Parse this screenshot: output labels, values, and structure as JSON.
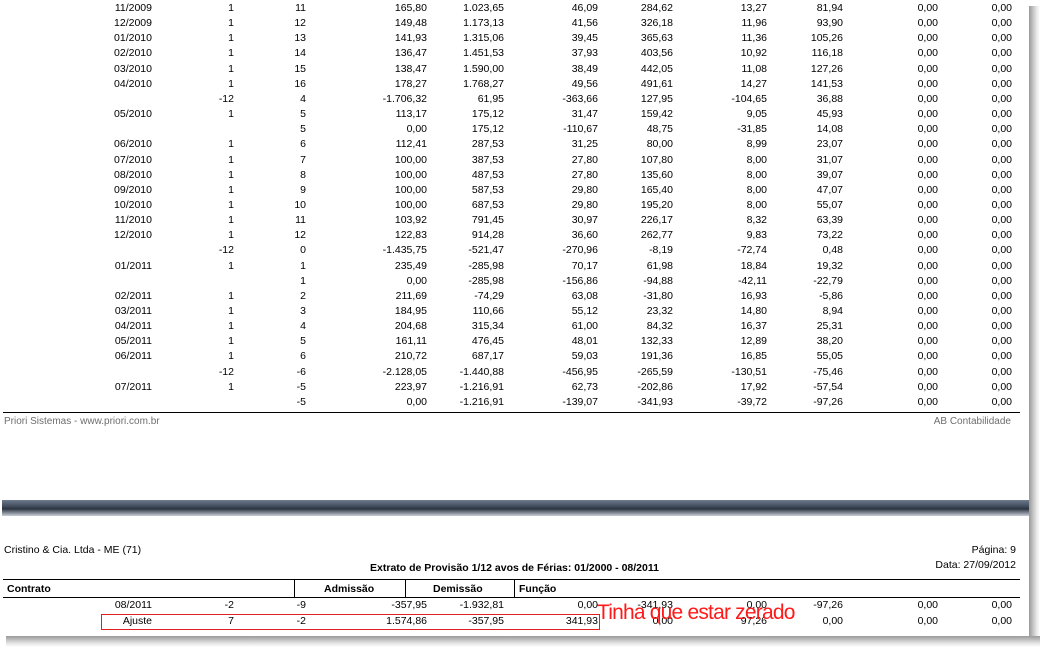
{
  "top_rows": [
    [
      "11/2009",
      "1",
      "11",
      "165,80",
      "1.023,65",
      "46,09",
      "284,62",
      "13,27",
      "81,94",
      "0,00",
      "0,00"
    ],
    [
      "12/2009",
      "1",
      "12",
      "149,48",
      "1.173,13",
      "41,56",
      "326,18",
      "11,96",
      "93,90",
      "0,00",
      "0,00"
    ],
    [
      "01/2010",
      "1",
      "13",
      "141,93",
      "1.315,06",
      "39,45",
      "365,63",
      "11,36",
      "105,26",
      "0,00",
      "0,00"
    ],
    [
      "02/2010",
      "1",
      "14",
      "136,47",
      "1.451,53",
      "37,93",
      "403,56",
      "10,92",
      "116,18",
      "0,00",
      "0,00"
    ],
    [
      "03/2010",
      "1",
      "15",
      "138,47",
      "1.590,00",
      "38,49",
      "442,05",
      "11,08",
      "127,26",
      "0,00",
      "0,00"
    ],
    [
      "04/2010",
      "1",
      "16",
      "178,27",
      "1.768,27",
      "49,56",
      "491,61",
      "14,27",
      "141,53",
      "0,00",
      "0,00"
    ],
    [
      "",
      "-12",
      "4",
      "-1.706,32",
      "61,95",
      "-363,66",
      "127,95",
      "-104,65",
      "36,88",
      "0,00",
      "0,00"
    ],
    [
      "05/2010",
      "1",
      "5",
      "113,17",
      "175,12",
      "31,47",
      "159,42",
      "9,05",
      "45,93",
      "0,00",
      "0,00"
    ],
    [
      "",
      "",
      "5",
      "0,00",
      "175,12",
      "-110,67",
      "48,75",
      "-31,85",
      "14,08",
      "0,00",
      "0,00"
    ],
    [
      "06/2010",
      "1",
      "6",
      "112,41",
      "287,53",
      "31,25",
      "80,00",
      "8,99",
      "23,07",
      "0,00",
      "0,00"
    ],
    [
      "07/2010",
      "1",
      "7",
      "100,00",
      "387,53",
      "27,80",
      "107,80",
      "8,00",
      "31,07",
      "0,00",
      "0,00"
    ],
    [
      "08/2010",
      "1",
      "8",
      "100,00",
      "487,53",
      "27,80",
      "135,60",
      "8,00",
      "39,07",
      "0,00",
      "0,00"
    ],
    [
      "09/2010",
      "1",
      "9",
      "100,00",
      "587,53",
      "29,80",
      "165,40",
      "8,00",
      "47,07",
      "0,00",
      "0,00"
    ],
    [
      "10/2010",
      "1",
      "10",
      "100,00",
      "687,53",
      "29,80",
      "195,20",
      "8,00",
      "55,07",
      "0,00",
      "0,00"
    ],
    [
      "11/2010",
      "1",
      "11",
      "103,92",
      "791,45",
      "30,97",
      "226,17",
      "8,32",
      "63,39",
      "0,00",
      "0,00"
    ],
    [
      "12/2010",
      "1",
      "12",
      "122,83",
      "914,28",
      "36,60",
      "262,77",
      "9,83",
      "73,22",
      "0,00",
      "0,00"
    ],
    [
      "",
      "-12",
      "0",
      "-1.435,75",
      "-521,47",
      "-270,96",
      "-8,19",
      "-72,74",
      "0,48",
      "0,00",
      "0,00"
    ],
    [
      "01/2011",
      "1",
      "1",
      "235,49",
      "-285,98",
      "70,17",
      "61,98",
      "18,84",
      "19,32",
      "0,00",
      "0,00"
    ],
    [
      "",
      "",
      "1",
      "0,00",
      "-285,98",
      "-156,86",
      "-94,88",
      "-42,11",
      "-22,79",
      "0,00",
      "0,00"
    ],
    [
      "02/2011",
      "1",
      "2",
      "211,69",
      "-74,29",
      "63,08",
      "-31,80",
      "16,93",
      "-5,86",
      "0,00",
      "0,00"
    ],
    [
      "03/2011",
      "1",
      "3",
      "184,95",
      "110,66",
      "55,12",
      "23,32",
      "14,80",
      "8,94",
      "0,00",
      "0,00"
    ],
    [
      "04/2011",
      "1",
      "4",
      "204,68",
      "315,34",
      "61,00",
      "84,32",
      "16,37",
      "25,31",
      "0,00",
      "0,00"
    ],
    [
      "05/2011",
      "1",
      "5",
      "161,11",
      "476,45",
      "48,01",
      "132,33",
      "12,89",
      "38,20",
      "0,00",
      "0,00"
    ],
    [
      "06/2011",
      "1",
      "6",
      "210,72",
      "687,17",
      "59,03",
      "191,36",
      "16,85",
      "55,05",
      "0,00",
      "0,00"
    ],
    [
      "",
      "-12",
      "-6",
      "-2.128,05",
      "-1.440,88",
      "-456,95",
      "-265,59",
      "-130,51",
      "-75,46",
      "0,00",
      "0,00"
    ],
    [
      "07/2011",
      "1",
      "-5",
      "223,97",
      "-1.216,91",
      "62,73",
      "-202,86",
      "17,92",
      "-57,54",
      "0,00",
      "0,00"
    ],
    [
      "",
      "",
      "-5",
      "0,00",
      "-1.216,91",
      "-139,07",
      "-341,93",
      "-39,72",
      "-97,26",
      "0,00",
      "0,00"
    ]
  ],
  "footer": {
    "left": "Priori Sistemas - www.priori.com.br",
    "right": "AB Contabilidade"
  },
  "header": {
    "company": "Cristino & Cia. Ltda - ME (71)",
    "page": "Página: 9",
    "title": "Extrato de Provisão 1/12 avos de Férias: 01/2000 - 08/2011",
    "date": "Data: 27/09/2012"
  },
  "columns": {
    "contrato": "Contrato",
    "admissao": "Admissão",
    "demissao": "Demissão",
    "funcao": "Função"
  },
  "bottom_rows": [
    [
      "08/2011",
      "-2",
      "-9",
      "-357,95",
      "-1.932,81",
      "0,00",
      "-341,93",
      "0,00",
      "-97,26",
      "0,00",
      "0,00"
    ],
    [
      "Ajuste",
      "7",
      "-2",
      "1.574,86",
      "-357,95",
      "341,93",
      "0,00",
      "97,26",
      "0,00",
      "0,00",
      "0,00"
    ]
  ],
  "annotation": "Tinha que estar zerado",
  "colors": {
    "annotation": "#ff1a1a",
    "separator": "#3a4555"
  }
}
